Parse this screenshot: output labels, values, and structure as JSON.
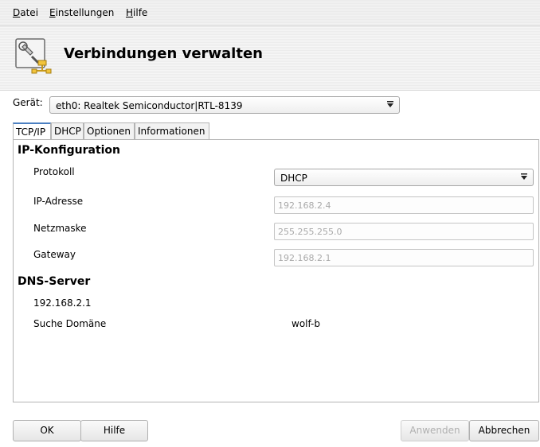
{
  "menu": {
    "datei_first": "D",
    "datei_rest": "atei",
    "einstellungen_first": "E",
    "einstellungen_rest": "instellungen",
    "hilfe_first": "H",
    "hilfe_rest": "ilfe"
  },
  "header": {
    "title": "Verbindungen verwalten",
    "icon": "network-tools-icon"
  },
  "device": {
    "label": "Gerät:",
    "value": "eth0: Realtek Semiconductor|RTL-8139"
  },
  "tabs": [
    {
      "label": "TCP/IP",
      "active": true
    },
    {
      "label": "DHCP"
    },
    {
      "label": "Optionen"
    },
    {
      "label": "Informationen"
    }
  ],
  "ip_config": {
    "heading": "IP-Konfiguration",
    "protocol_label": "Protokoll",
    "protocol_value": "DHCP",
    "ip_label": "IP-Adresse",
    "ip_value": "192.168.2.4",
    "netmask_label": "Netzmaske",
    "netmask_value": "255.255.255.0",
    "gateway_label": "Gateway",
    "gateway_value": "192.168.2.1"
  },
  "dns": {
    "heading": "DNS-Server",
    "server": "192.168.2.1",
    "search_label": "Suche Domäne",
    "search_value": "wolf-b"
  },
  "buttons": {
    "ok": "OK",
    "help": "Hilfe",
    "apply": "Anwenden",
    "cancel": "Abbrechen"
  }
}
